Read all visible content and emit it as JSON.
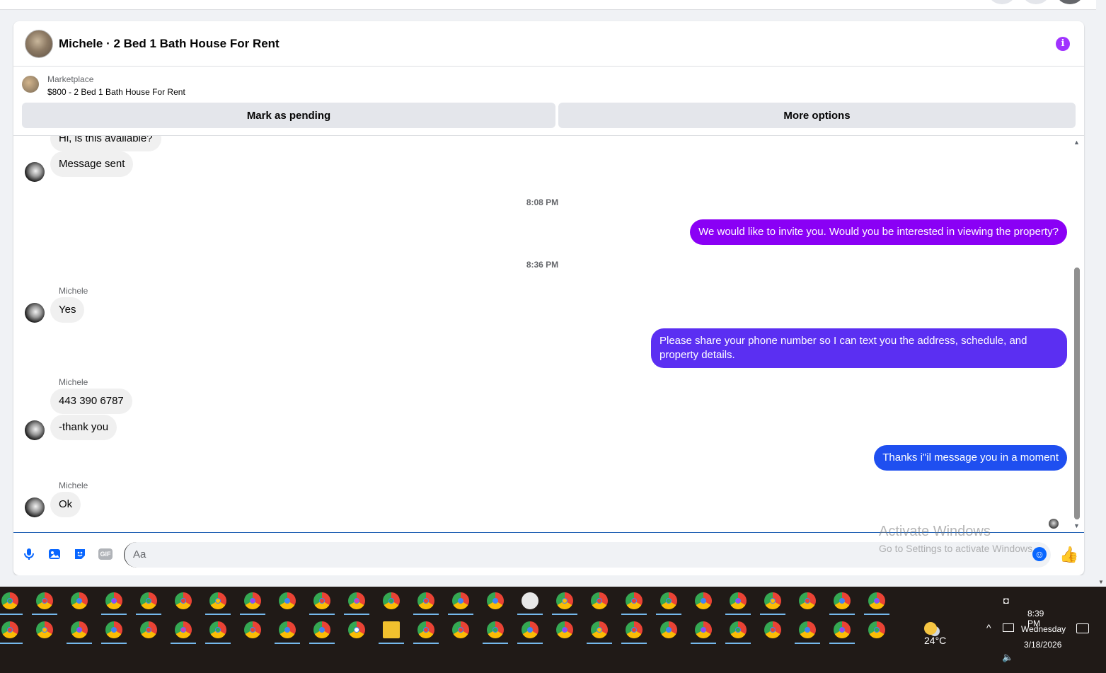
{
  "header": {
    "title": "Michele · 2 Bed 1 Bath House For Rent",
    "info_icon": "info-icon",
    "info_color": "#a033ff"
  },
  "listing": {
    "label": "Marketplace",
    "subtitle": "$800 - 2 Bed 1 Bath House For Rent",
    "pending_button": "Mark as pending",
    "more_button": "More options"
  },
  "thread": {
    "partial_message": "Hi, is this available?",
    "message_sent": "Message sent",
    "time_1": "8:08 PM",
    "out_1": "We would like to invite you. Would you be interested in viewing the property?",
    "time_2": "8:36 PM",
    "sender_1": "Michele",
    "in_yes": "Yes",
    "out_2": "Please share your phone number so I can text you the address, schedule, and property details.",
    "sender_2": "Michele",
    "in_phone": "443 390 6787",
    "in_thanks": "-thank you",
    "out_3": "Thanks i\"il message you in a moment",
    "sender_3": "Michele",
    "in_ok": "Ok"
  },
  "colors": {
    "out_1": "#8a00f5",
    "out_2": "#5b2ff2",
    "out_3": "#1f4ff0",
    "accent": "#0866ff"
  },
  "composer": {
    "placeholder": "Aa",
    "icons": [
      "microphone-icon",
      "photo-icon",
      "sticker-icon",
      "gif-icon",
      "emoji-icon",
      "like-icon"
    ],
    "gif_label": "GIF"
  },
  "watermark": {
    "line1": "Activate Windows",
    "line2": "Go to Settings to activate Windows."
  },
  "taskbar": {
    "weather": "24°C",
    "time": "8:39 PM",
    "day": "Wednesday",
    "date": "3/18/2026"
  }
}
